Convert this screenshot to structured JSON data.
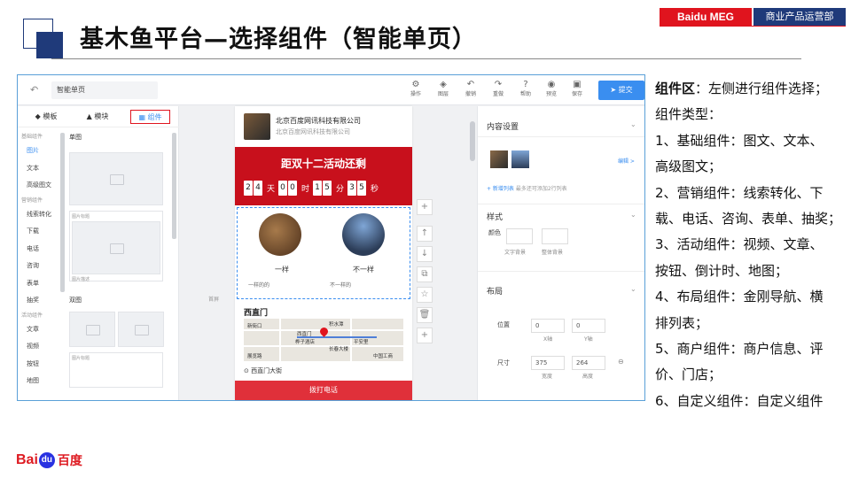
{
  "slide": {
    "title": "基木鱼平台—选择组件（智能单页）",
    "badge_left": "Baidu MEG",
    "badge_right": "商业产品运营部",
    "logo_text_a": "Bai",
    "logo_text_paw": "du",
    "logo_text_cn": "百度"
  },
  "editor": {
    "doc_title": "智能单页",
    "toolbar": [
      {
        "label": "操作",
        "icon": "operation-icon"
      },
      {
        "label": "图层",
        "icon": "layers-icon"
      },
      {
        "label": "撤销",
        "icon": "undo-icon"
      },
      {
        "label": "重做",
        "icon": "redo-icon"
      },
      {
        "label": "帮助",
        "icon": "help-icon"
      },
      {
        "label": "预览",
        "icon": "preview-icon"
      },
      {
        "label": "保存",
        "icon": "save-icon"
      }
    ],
    "submit_label": "提交",
    "tabs": [
      "模板",
      "模块",
      "组件"
    ],
    "categories": {
      "basic_head": "基础组件",
      "basic_items": [
        "图片",
        "文本",
        "高级图文"
      ],
      "marketing_head": "营销组件",
      "marketing_items": [
        "线索转化",
        "下载",
        "电话",
        "咨询",
        "表单",
        "抽奖"
      ],
      "activity_head": "活动组件",
      "activity_items": [
        "文章",
        "视频",
        "按钮",
        "地图"
      ]
    },
    "components": {
      "single_label": "单图",
      "single_caption_title": "图片标题",
      "single_caption_desc": "图片描述",
      "double_label": "双图",
      "double_caption": "图片标题"
    },
    "phone": {
      "biz_name": "北京百度网讯科技有限公司",
      "biz_sub": "北京百度网讯科技有限公司",
      "countdown_title": "距双十二活动还剩",
      "countdown": [
        {
          "digits": [
            "2",
            "4"
          ],
          "unit": "天"
        },
        {
          "digits": [
            "0",
            "0"
          ],
          "unit": "时"
        },
        {
          "digits": [
            "1",
            "5"
          ],
          "unit": "分"
        },
        {
          "digits": [
            "3",
            "5"
          ],
          "unit": "秒"
        }
      ],
      "item1_title": "一样",
      "item1_sub": "一样的的",
      "item2_title": "不一样",
      "item2_sub": "不一样的",
      "map_title": "西直门",
      "map_labels": [
        "新街口",
        "积水潭",
        "西直门",
        "平安里",
        "长春大楼",
        "桦子酒店",
        "中国工商",
        "展览路"
      ],
      "address": "西直门大街",
      "call_label": "拨打电话",
      "guide_label": "首屏"
    },
    "props": {
      "content_title": "内容设置",
      "edit_link": "编辑 >",
      "add_list": "+ 新增列表",
      "add_tip": "最多还可添加2行列表",
      "style_title": "样式",
      "color_label": "颜色",
      "text_bg": "文字背景",
      "whole_bg": "整体背景",
      "layout_title": "布局",
      "pos_label": "位置",
      "x_val": "0",
      "y_val": "0",
      "x_cap": "X轴",
      "y_cap": "Y轴",
      "size_label": "尺寸",
      "w_val": "375",
      "h_val": "264",
      "w_cap": "宽度",
      "h_cap": "高度"
    }
  },
  "description": {
    "key": "组件区",
    "intro": "：左侧进行组件选择；",
    "lines": [
      "组件类型：",
      "1、基础组件：图文、文本、",
      "高级图文；",
      "2、营销组件：线索转化、下",
      "载、电话、咨询、表单、抽奖；",
      "3、活动组件：视频、文章、",
      "按钮、倒计时、地图；",
      "4、布局组件：金刚导航、横",
      "排列表；",
      "5、商户组件：商户信息、评",
      "价、门店；",
      "6、自定义组件：自定义组件"
    ]
  }
}
